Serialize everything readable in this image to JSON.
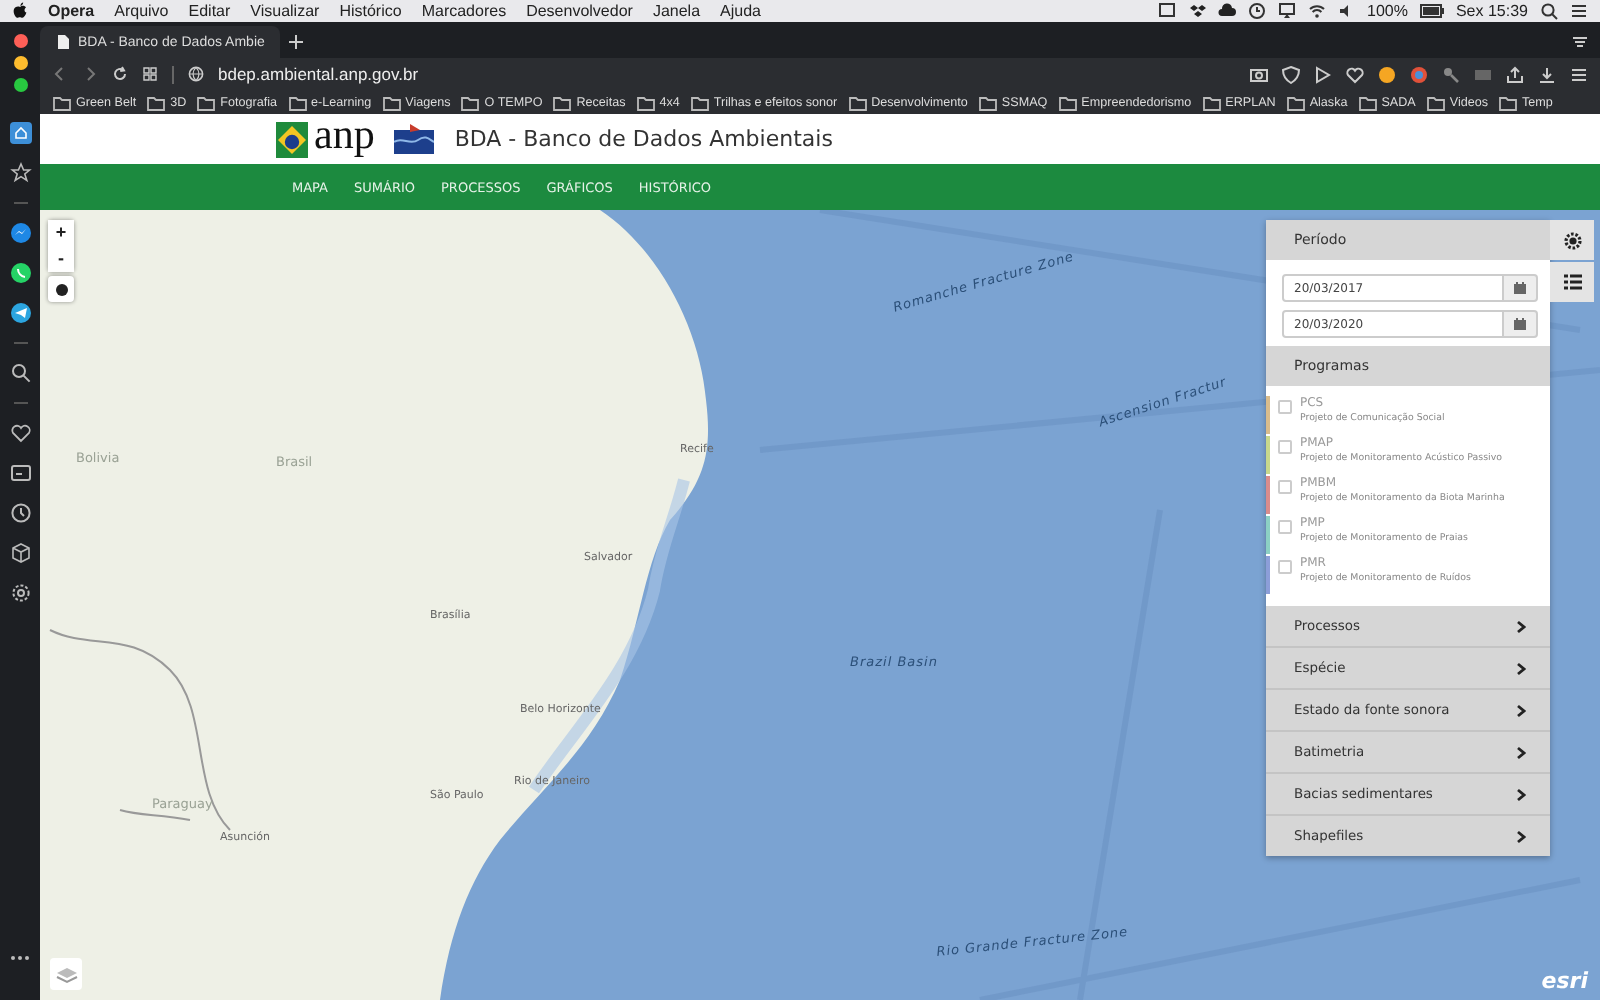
{
  "menubar": {
    "app": "Opera",
    "menus": [
      "Arquivo",
      "Editar",
      "Visualizar",
      "Histórico",
      "Marcadores",
      "Desenvolvedor",
      "Janela",
      "Ajuda"
    ],
    "battery": "100%",
    "clock": "Sex 15:39"
  },
  "browser": {
    "tab_title": "BDA - Banco de Dados Ambie",
    "url": "bdep.ambiental.anp.gov.br",
    "bookmarks": [
      "Green Belt",
      "3D",
      "Fotografia",
      "e-Learning",
      "Viagens",
      "O TEMPO",
      "Receitas",
      "4x4",
      "Trilhas e efeitos sonor",
      "Desenvolvimento",
      "SSMAQ",
      "Empreendedorismo",
      "ERPLAN",
      "Alaska",
      "SADA",
      "Videos",
      "Temp"
    ]
  },
  "site": {
    "logo": "anp",
    "title": "BDA - Banco de Dados Ambientais",
    "nav": [
      "MAPA",
      "SUMÁRIO",
      "PROCESSOS",
      "GRÁFICOS",
      "HISTÓRICO"
    ]
  },
  "map": {
    "zoom_in": "+",
    "zoom_out": "-",
    "attribution": "esri",
    "labels": [
      {
        "text": "Brasil",
        "kind": "land"
      },
      {
        "text": "Bolivia",
        "kind": "land"
      },
      {
        "text": "Recife",
        "kind": "city"
      },
      {
        "text": "Salvador",
        "kind": "city"
      },
      {
        "text": "Brasília",
        "kind": "city"
      },
      {
        "text": "Belo Horizonte",
        "kind": "city"
      },
      {
        "text": "Rio de Janeiro",
        "kind": "city"
      },
      {
        "text": "São Paulo",
        "kind": "city"
      },
      {
        "text": "Paraguay",
        "kind": "land"
      },
      {
        "text": "Asunción",
        "kind": "city"
      },
      {
        "text": "Romanche Fracture Zone",
        "kind": "sea"
      },
      {
        "text": "Ascension Fractur",
        "kind": "sea"
      },
      {
        "text": "Brazil Basin",
        "kind": "sea"
      },
      {
        "text": "Rio Grande Fracture Zone",
        "kind": "sea"
      }
    ]
  },
  "panel": {
    "period": {
      "title": "Período",
      "start": "20/03/2017",
      "end": "20/03/2020"
    },
    "programs": {
      "title": "Programas",
      "items": [
        {
          "code": "PCS",
          "name": "Projeto de Comunicação Social",
          "color": "#d9bc8c",
          "checked": false
        },
        {
          "code": "PMAP",
          "name": "Projeto de Monitoramento Acústico Passivo",
          "color": "#c8d88c",
          "checked": false
        },
        {
          "code": "PMBM",
          "name": "Projeto de Monitoramento da Biota Marinha",
          "color": "#d98c8c",
          "checked": false
        },
        {
          "code": "PMP",
          "name": "Projeto de Monitoramento de Praias",
          "color": "#8cd0c4",
          "checked": false
        },
        {
          "code": "PMR",
          "name": "Projeto de Monitoramento de Ruídos",
          "color": "#8c9ed8",
          "checked": false
        }
      ]
    },
    "sections": [
      "Processos",
      "Espécie",
      "Estado da fonte sonora",
      "Batimetria",
      "Bacias sedimentares",
      "Shapefiles"
    ]
  }
}
